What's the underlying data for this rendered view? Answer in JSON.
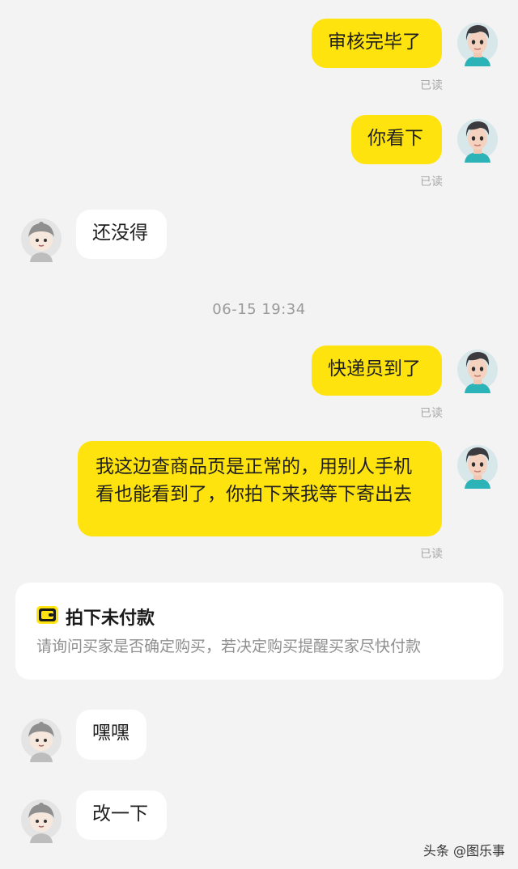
{
  "messages": [
    {
      "text": "审核完毕了",
      "read": "已读"
    },
    {
      "text": "你看下",
      "read": "已读"
    },
    {
      "text": "还没得"
    },
    {
      "text": "快递员到了",
      "read": "已读"
    },
    {
      "text": "我这边查商品页是正常的，用别人手机看也能看到了，你拍下来我等下寄出去",
      "read": "已读"
    },
    {
      "text": "嘿嘿"
    },
    {
      "text": "改一下"
    }
  ],
  "timestamp": "06-15 19:34",
  "order_card": {
    "title": "拍下未付款",
    "description": "请询问买家是否确定购买，若决定购买提醒买家尽快付款",
    "icon": "wallet-icon",
    "accent": "#ffe30f"
  },
  "watermark": "头条 @图乐事",
  "colors": {
    "my_bubble": "#ffe30f",
    "peer_bubble": "#ffffff",
    "background": "#f3f3f3"
  }
}
